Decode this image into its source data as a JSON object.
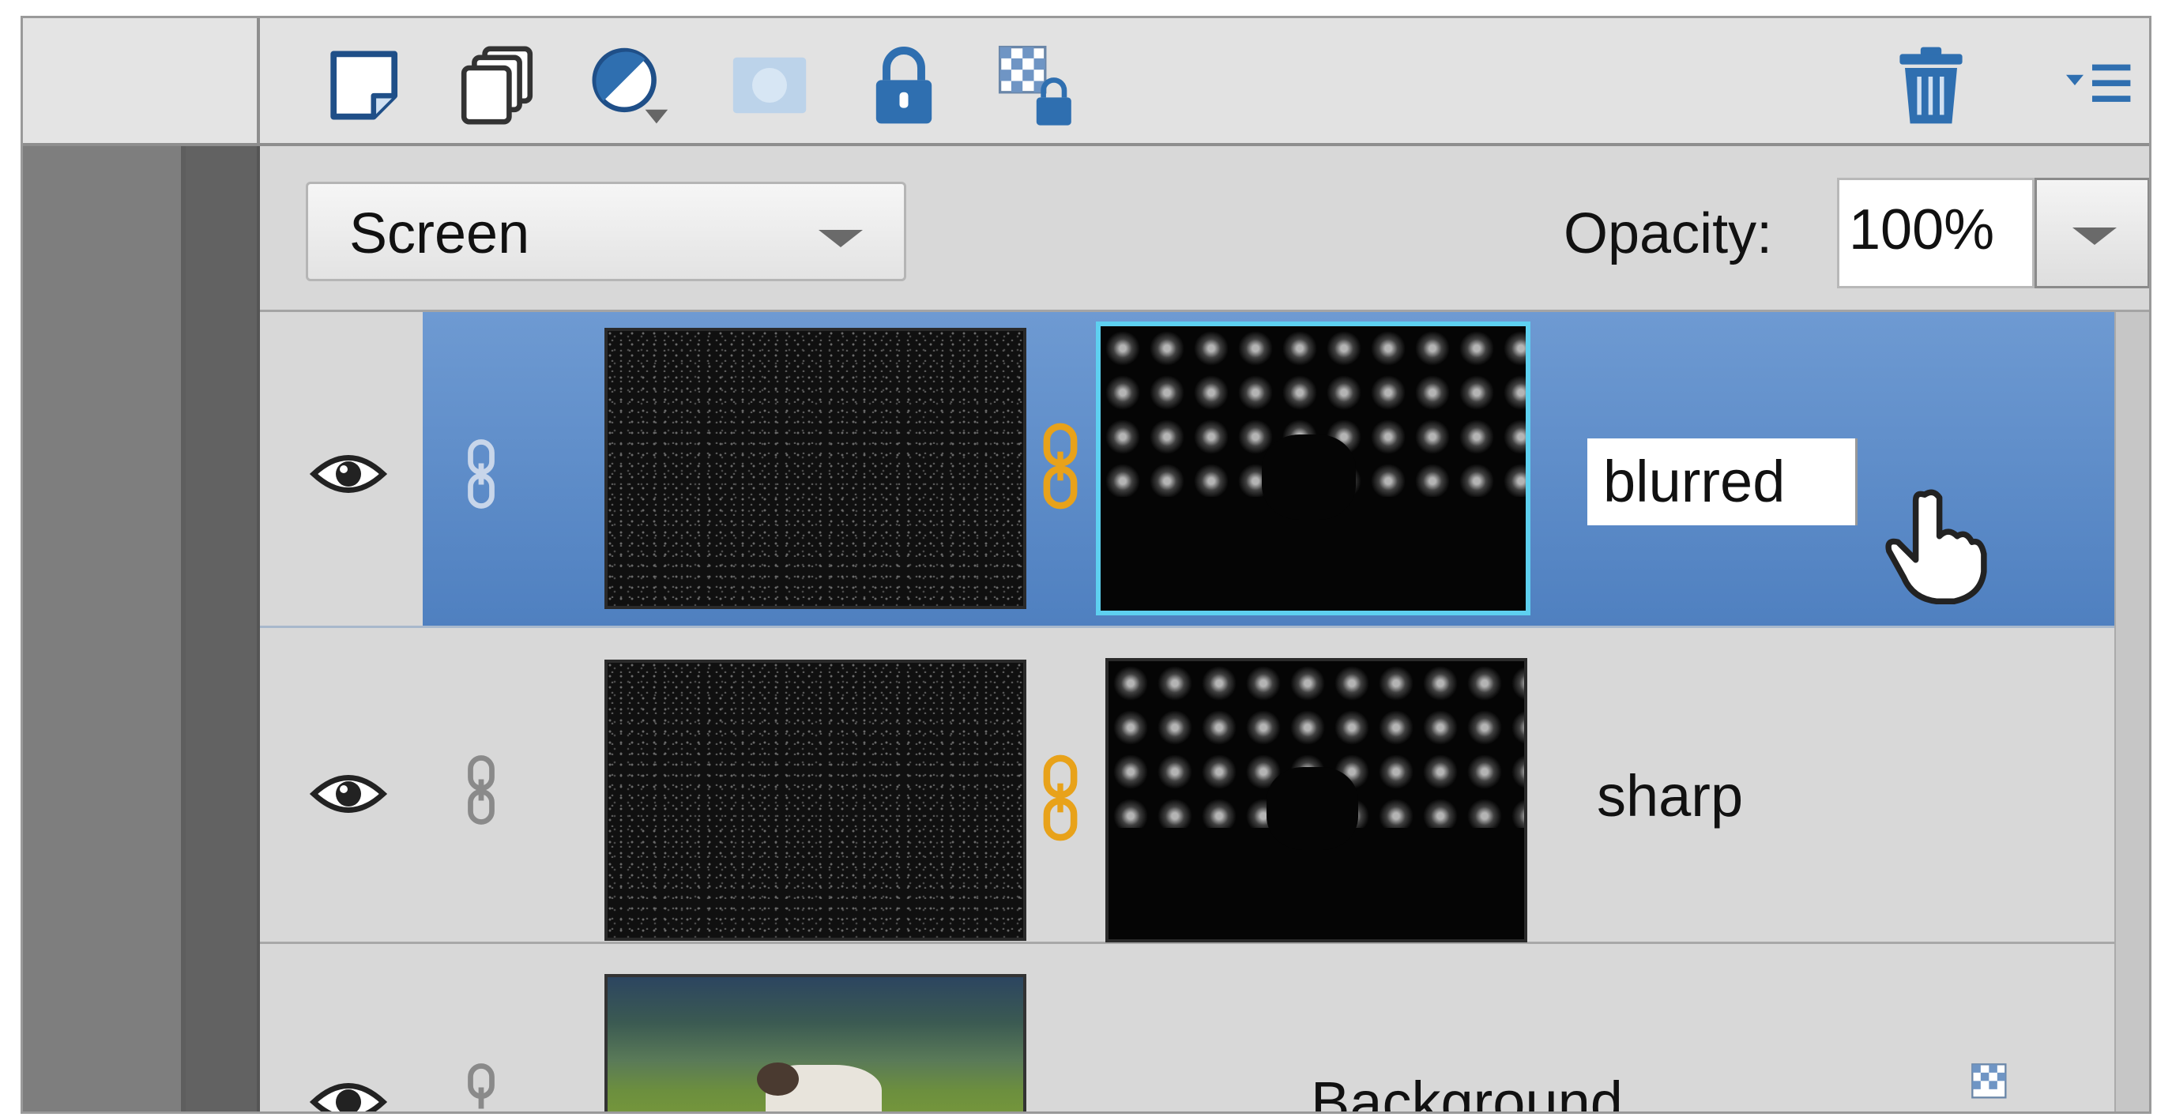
{
  "toolbar": {
    "buttons": [
      "new-layer",
      "new-group",
      "new-adjustment-layer",
      "add-layer-mask",
      "lock-all",
      "lock-transparent-pixels",
      "delete-layer",
      "panel-menu"
    ]
  },
  "blend": {
    "label": "Screen",
    "opacity_label": "Opacity:",
    "opacity_value": "100%"
  },
  "layers": [
    {
      "name": "blurred",
      "selected": true,
      "editing": true
    },
    {
      "name": "sharp",
      "selected": false,
      "editing": false
    },
    {
      "name": "Background",
      "selected": false,
      "editing": false
    }
  ],
  "colors": {
    "selected_row": "#5b8ccc",
    "panel_bg": "#d6d6d6",
    "link_orange": "#e8a21a",
    "icon_blue": "#2f6fb0"
  }
}
